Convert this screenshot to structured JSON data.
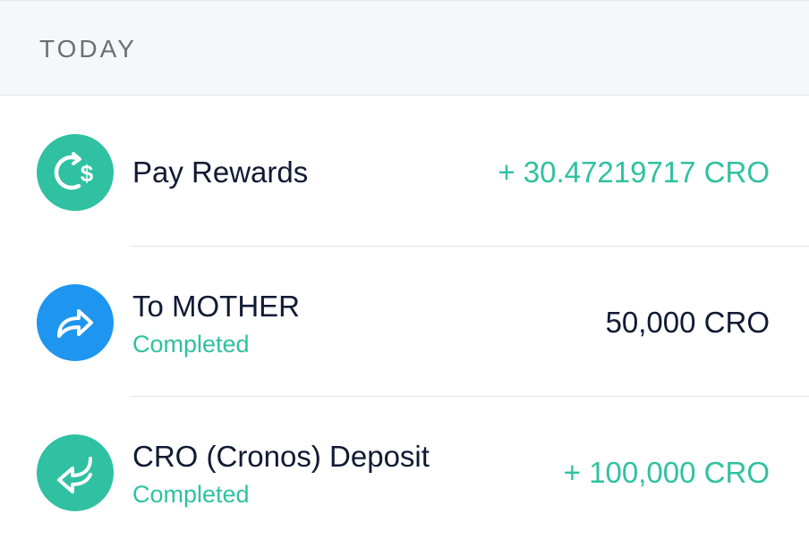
{
  "section": {
    "label": "TODAY"
  },
  "colors": {
    "accent_green": "#2fc1a1",
    "accent_blue": "#1e96f0",
    "text_dark": "#101a33",
    "header_bg": "#f6f7f9"
  },
  "transactions": [
    {
      "icon": "cashback-dollar-icon",
      "title": "Pay Rewards",
      "status": "",
      "amount": "+ 30.47219717 CRO",
      "amount_color": "green"
    },
    {
      "icon": "send-arrow-icon",
      "title": "To MOTHER",
      "status": "Completed",
      "amount": "50,000 CRO",
      "amount_color": "dark"
    },
    {
      "icon": "deposit-arrow-icon",
      "title": "CRO (Cronos) Deposit",
      "status": "Completed",
      "amount": "+ 100,000 CRO",
      "amount_color": "green"
    }
  ]
}
